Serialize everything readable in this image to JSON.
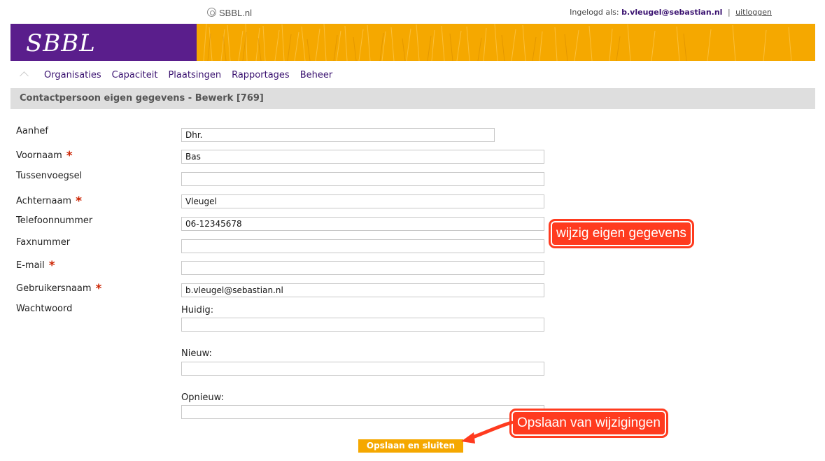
{
  "header": {
    "site_name": "SBBL.nl",
    "logged_in_prefix": "Ingelogd als:",
    "user": "b.vleugel@sebastian.nl",
    "separator": "|",
    "logout": "uitloggen"
  },
  "banner": {
    "brand": "SBBL",
    "brand_color": "#5a1e8c",
    "accent_color": "#f5a800"
  },
  "nav": {
    "home_icon": "home-icon",
    "items": [
      "Organisaties",
      "Capaciteit",
      "Plaatsingen",
      "Rapportages",
      "Beheer"
    ]
  },
  "page_title": "Contactpersoon eigen gegevens - Bewerk [769]",
  "form": {
    "required_mark": "*",
    "aanhef": {
      "label": "Aanhef",
      "value": "Dhr."
    },
    "voornaam": {
      "label": "Voornaam",
      "value": "Bas"
    },
    "tussenvoegsel": {
      "label": "Tussenvoegsel",
      "value": ""
    },
    "achternaam": {
      "label": "Achternaam",
      "value": "Vleugel"
    },
    "telefoon": {
      "label": "Telefoonnummer",
      "value": "06-12345678"
    },
    "fax": {
      "label": "Faxnummer",
      "value": ""
    },
    "email": {
      "label": "E-mail",
      "value": ""
    },
    "gebruikersnaam": {
      "label": "Gebruikersnaam",
      "value": "b.vleugel@sebastian.nl"
    },
    "wachtwoord": {
      "label": "Wachtwoord",
      "huidig_label": "Huidig:",
      "nieuw_label": "Nieuw:",
      "opnieuw_label": "Opnieuw:"
    },
    "save_button": "Opslaan en sluiten"
  },
  "annotations": {
    "callout_edit": "wijzig eigen gegevens",
    "callout_save": "Opslaan van wijzigingen",
    "callout_color": "#ff3b1f"
  }
}
